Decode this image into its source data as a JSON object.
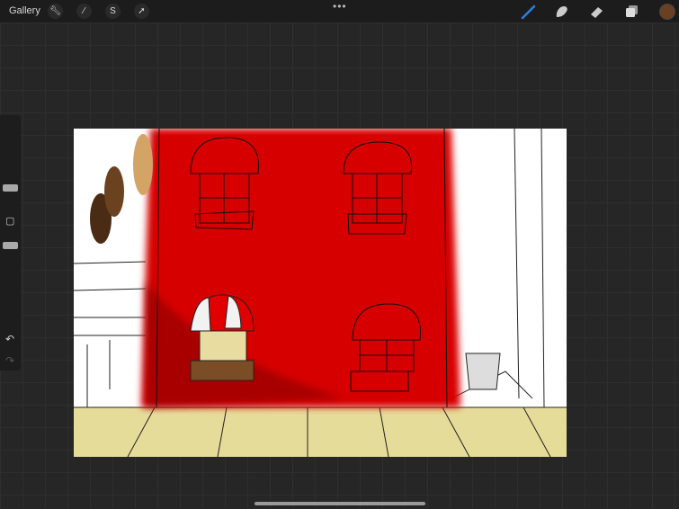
{
  "topbar": {
    "gallery_label": "Gallery",
    "more_label": "•••",
    "left_tools": [
      "wrench-icon",
      "magic-wand-icon",
      "selection-icon",
      "transform-arrow-icon"
    ],
    "right_tools": [
      "brush-icon",
      "smudge-icon",
      "eraser-icon",
      "layers-icon"
    ],
    "current_color": "#6b3f22",
    "accent_color": "#2f7fe0"
  },
  "sidebar": {
    "undo_label": "↶",
    "redo_label": "↷",
    "modify_label": "▢"
  },
  "artwork": {
    "palette": [
      "#4a2c14",
      "#6b4220",
      "#d4a366"
    ],
    "wall_color": "#d60000"
  }
}
